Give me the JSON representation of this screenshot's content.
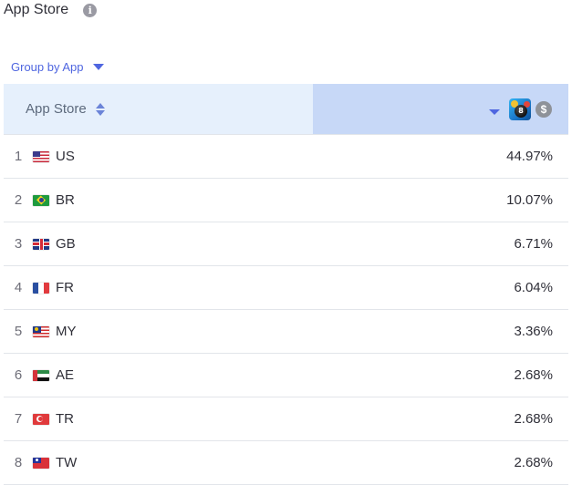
{
  "header": {
    "title": "App Store",
    "info_icon": "info-icon"
  },
  "controls": {
    "group_by_label": "Group by App"
  },
  "table": {
    "columns": {
      "store": "App Store",
      "value_icon": "dollar-icon",
      "app_icon": "pool-game-app-icon",
      "ball_number": "8"
    },
    "rows": [
      {
        "rank": "1",
        "flag": "us",
        "country": "US",
        "value": "44.97%"
      },
      {
        "rank": "2",
        "flag": "br",
        "country": "BR",
        "value": "10.07%"
      },
      {
        "rank": "3",
        "flag": "gb",
        "country": "GB",
        "value": "6.71%"
      },
      {
        "rank": "4",
        "flag": "fr",
        "country": "FR",
        "value": "6.04%"
      },
      {
        "rank": "5",
        "flag": "my",
        "country": "MY",
        "value": "3.36%"
      },
      {
        "rank": "6",
        "flag": "ae",
        "country": "AE",
        "value": "2.68%"
      },
      {
        "rank": "7",
        "flag": "tr",
        "country": "TR",
        "value": "2.68%"
      },
      {
        "rank": "8",
        "flag": "tw",
        "country": "TW",
        "value": "2.68%"
      }
    ]
  },
  "colors": {
    "accent": "#4f66e0",
    "header_store_bg": "#e6f0fc",
    "header_value_bg": "#c7d8f7",
    "row_border": "#e2e5ea"
  }
}
